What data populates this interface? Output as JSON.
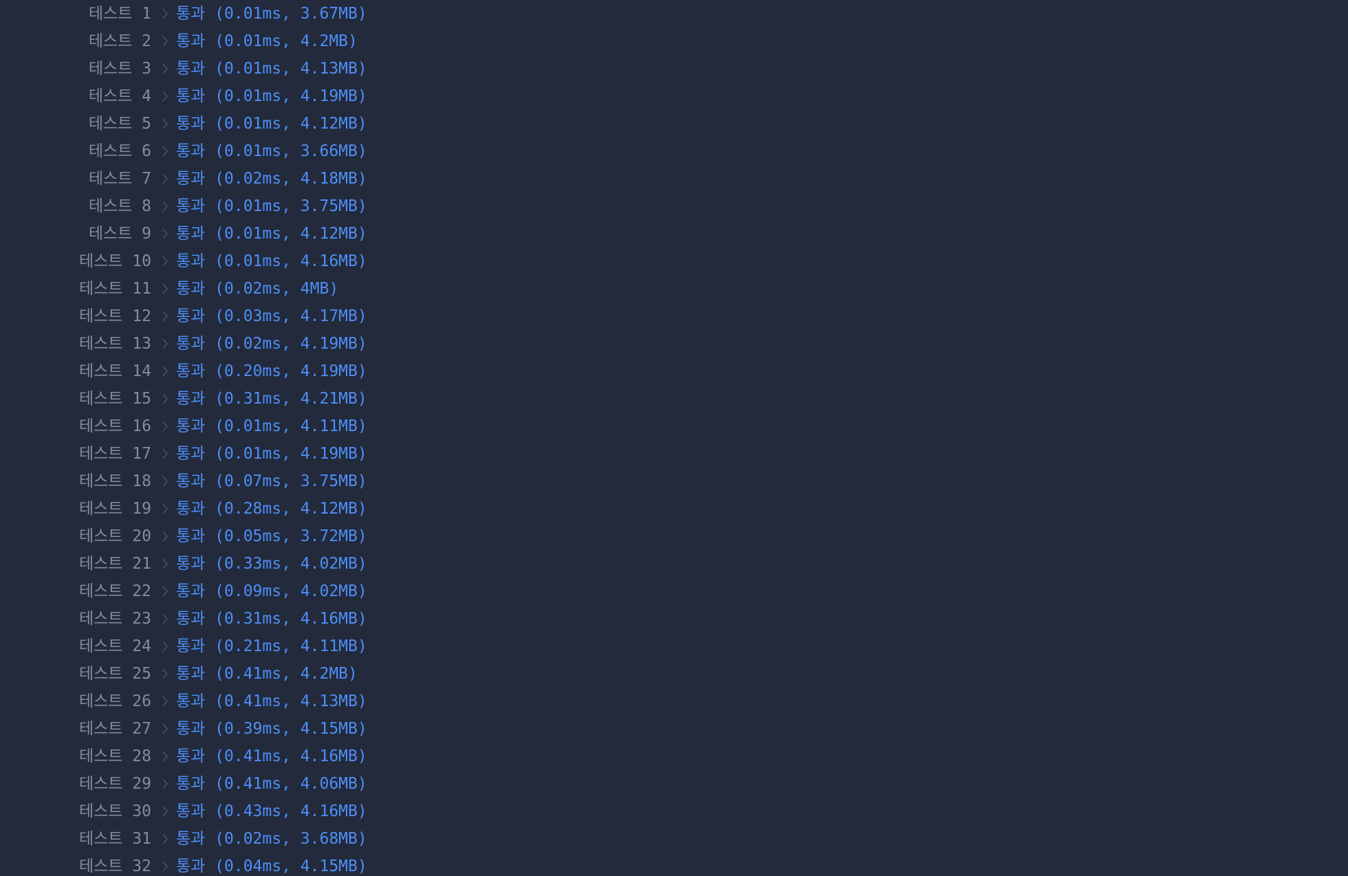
{
  "colors": {
    "background": "#222a3b",
    "label": "#858c9b",
    "pass": "#4f8ef7",
    "chevron": "#4a5263"
  },
  "separator_icon": "chevron-right-icon",
  "tests": [
    {
      "label": "테스트 1",
      "result": "통과 (0.01ms, 3.67MB)"
    },
    {
      "label": "테스트 2",
      "result": "통과 (0.01ms, 4.2MB)"
    },
    {
      "label": "테스트 3",
      "result": "통과 (0.01ms, 4.13MB)"
    },
    {
      "label": "테스트 4",
      "result": "통과 (0.01ms, 4.19MB)"
    },
    {
      "label": "테스트 5",
      "result": "통과 (0.01ms, 4.12MB)"
    },
    {
      "label": "테스트 6",
      "result": "통과 (0.01ms, 3.66MB)"
    },
    {
      "label": "테스트 7",
      "result": "통과 (0.02ms, 4.18MB)"
    },
    {
      "label": "테스트 8",
      "result": "통과 (0.01ms, 3.75MB)"
    },
    {
      "label": "테스트 9",
      "result": "통과 (0.01ms, 4.12MB)"
    },
    {
      "label": "테스트 10",
      "result": "통과 (0.01ms, 4.16MB)"
    },
    {
      "label": "테스트 11",
      "result": "통과 (0.02ms, 4MB)"
    },
    {
      "label": "테스트 12",
      "result": "통과 (0.03ms, 4.17MB)"
    },
    {
      "label": "테스트 13",
      "result": "통과 (0.02ms, 4.19MB)"
    },
    {
      "label": "테스트 14",
      "result": "통과 (0.20ms, 4.19MB)"
    },
    {
      "label": "테스트 15",
      "result": "통과 (0.31ms, 4.21MB)"
    },
    {
      "label": "테스트 16",
      "result": "통과 (0.01ms, 4.11MB)"
    },
    {
      "label": "테스트 17",
      "result": "통과 (0.01ms, 4.19MB)"
    },
    {
      "label": "테스트 18",
      "result": "통과 (0.07ms, 3.75MB)"
    },
    {
      "label": "테스트 19",
      "result": "통과 (0.28ms, 4.12MB)"
    },
    {
      "label": "테스트 20",
      "result": "통과 (0.05ms, 3.72MB)"
    },
    {
      "label": "테스트 21",
      "result": "통과 (0.33ms, 4.02MB)"
    },
    {
      "label": "테스트 22",
      "result": "통과 (0.09ms, 4.02MB)"
    },
    {
      "label": "테스트 23",
      "result": "통과 (0.31ms, 4.16MB)"
    },
    {
      "label": "테스트 24",
      "result": "통과 (0.21ms, 4.11MB)"
    },
    {
      "label": "테스트 25",
      "result": "통과 (0.41ms, 4.2MB)"
    },
    {
      "label": "테스트 26",
      "result": "통과 (0.41ms, 4.13MB)"
    },
    {
      "label": "테스트 27",
      "result": "통과 (0.39ms, 4.15MB)"
    },
    {
      "label": "테스트 28",
      "result": "통과 (0.41ms, 4.16MB)"
    },
    {
      "label": "테스트 29",
      "result": "통과 (0.41ms, 4.06MB)"
    },
    {
      "label": "테스트 30",
      "result": "통과 (0.43ms, 4.16MB)"
    },
    {
      "label": "테스트 31",
      "result": "통과 (0.02ms, 3.68MB)"
    },
    {
      "label": "테스트 32",
      "result": "통과 (0.04ms, 4.15MB)"
    }
  ]
}
